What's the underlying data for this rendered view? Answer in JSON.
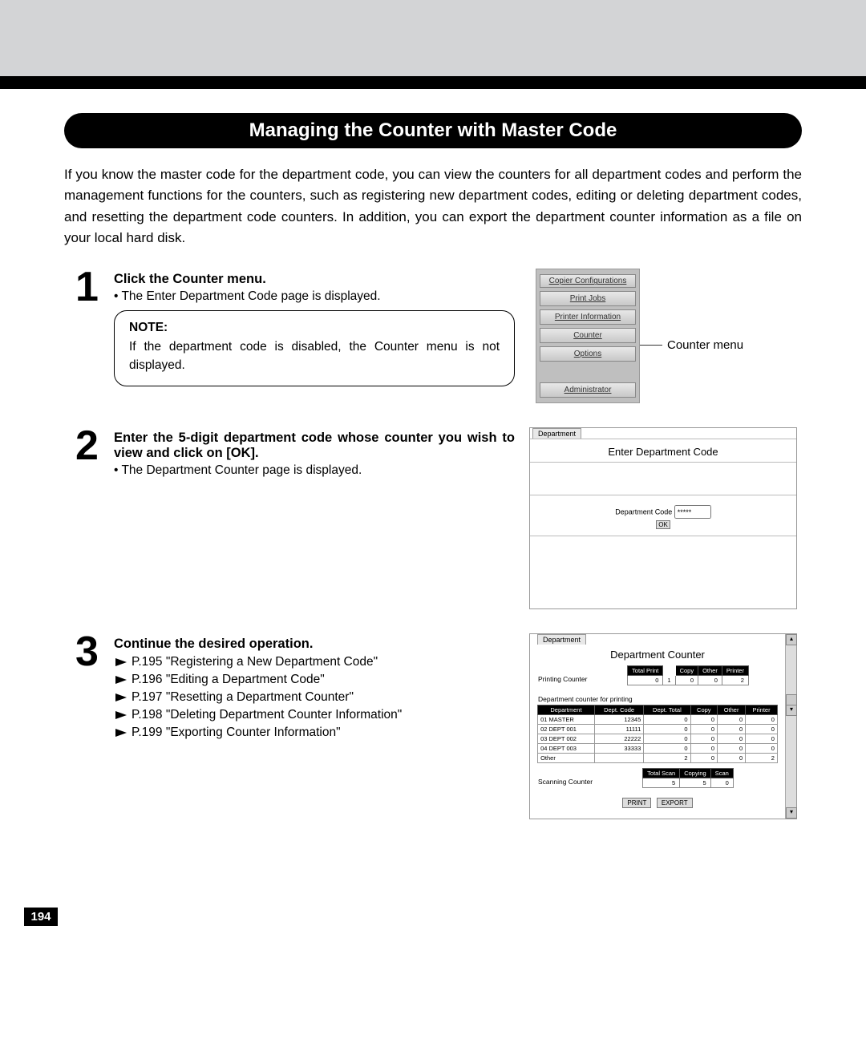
{
  "header": "Managing the Counter with Master Code",
  "intro": "If you know the master code for the department code, you can view the counters for all department codes and perform the management functions for the counters, such as registering new department codes, editing or deleting department codes, and resetting the department code counters.  In addition, you can export the department counter information as a file on your local hard disk.",
  "step1": {
    "num": "1",
    "title": "Click the Counter menu.",
    "bullet": "• The Enter Department Code page is displayed.",
    "note_label": "NOTE:",
    "note_text": "If the department code is disabled, the Counter menu is not displayed.",
    "menu": {
      "items": [
        "Copier Configurations",
        "Print Jobs",
        "Printer Information",
        "Counter",
        "Options",
        "Administrator"
      ],
      "callout": "Counter menu"
    }
  },
  "step2": {
    "num": "2",
    "title": "Enter the 5-digit department code whose counter you wish to view and click on [OK].",
    "bullet": "• The Department Counter page is displayed.",
    "panel": {
      "tab": "Department",
      "title": "Enter Department Code",
      "label": "Department Code",
      "value": "*****",
      "ok": "OK"
    }
  },
  "step3": {
    "num": "3",
    "title": "Continue the desired operation.",
    "links": [
      "P.195 \"Registering a New Department Code\"",
      "P.196 \"Editing a Department Code\"",
      "P.197 \"Resetting a Department Counter\"",
      "P.198 \"Deleting Department Counter Information\"",
      "P.199 \"Exporting Counter Information\""
    ],
    "panel": {
      "tab": "Department",
      "title": "Department Counter",
      "printing_label": "Printing Counter",
      "print_headers": [
        "Total Print",
        "",
        "Copy",
        "Other",
        "Printer"
      ],
      "print_values": [
        "0",
        "1",
        "0",
        "0",
        "2"
      ],
      "dept_label": "Department counter for printing",
      "dept_headers": [
        "Department",
        "Dept. Code",
        "Dept. Total",
        "Copy",
        "Other",
        "Printer"
      ],
      "dept_rows": [
        [
          "01 MASTER",
          "12345",
          "0",
          "0",
          "0",
          "0"
        ],
        [
          "02 DEPT 001",
          "11111",
          "0",
          "0",
          "0",
          "0"
        ],
        [
          "03 DEPT 002",
          "22222",
          "0",
          "0",
          "0",
          "0"
        ],
        [
          "04 DEPT 003",
          "33333",
          "0",
          "0",
          "0",
          "0"
        ],
        [
          "Other",
          "",
          "2",
          "0",
          "0",
          "2"
        ]
      ],
      "scan_label": "Scanning Counter",
      "scan_headers": [
        "Total Scan",
        "Copying",
        "Scan"
      ],
      "scan_values": [
        "5",
        "5",
        "0"
      ],
      "print_btn": "PRINT",
      "export_btn": "EXPORT"
    }
  },
  "page_number": "194"
}
